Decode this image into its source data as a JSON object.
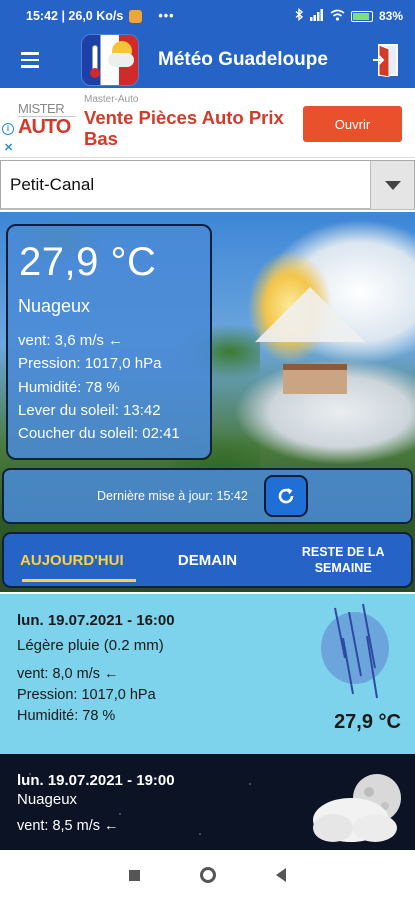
{
  "status_bar": {
    "time_speed": "15:42 | 26,0 Ko/s",
    "dots": "•••",
    "battery": "83"
  },
  "header": {
    "title": "Météo Guadeloupe"
  },
  "ad": {
    "logo_line1": "MISTER",
    "logo_line2": "AUTO",
    "brand": "Master-Auto",
    "headline": "Vente Pièces Auto Prix Bas",
    "button": "Ouvrir"
  },
  "location": {
    "selected": "Petit-Canal"
  },
  "current": {
    "temperature": "27,9 °C",
    "condition": "Nuageux",
    "wind": "vent: 3,6 m/s ←",
    "pressure": "Pression: 1017,0 hPa",
    "humidity": "Humidité: 78 %",
    "sunrise": "Lever du soleil: 13:42",
    "sunset": "Coucher du soleil: 02:41"
  },
  "update": {
    "text": "Dernière mise à jour: 15:42"
  },
  "tabs": [
    {
      "label": "AUJOURD'HUI"
    },
    {
      "label": "DEMAIN"
    },
    {
      "label": "RESTE DE LA SEMAINE"
    }
  ],
  "forecast": [
    {
      "date": "lun. 19.07.2021 - 16:00",
      "condition": "Légère pluie (0.2 mm)",
      "wind": "vent: 8,0 m/s ←",
      "pressure": "Pression: 1017,0 hPa",
      "humidity": "Humidité: 78 %",
      "temperature": "27,9 °C",
      "icon": "rain-icon"
    },
    {
      "date": "lun. 19.07.2021 - 19:00",
      "condition": "Nuageux",
      "wind": "vent: 8,5 m/s ←",
      "icon": "cloud-moon-icon"
    }
  ],
  "colors": {
    "primary": "#2563c7",
    "accent_tab": "#ffd23b",
    "ad_red": "#d23b2a",
    "forecast_day_bg": "#7dd3ec",
    "forecast_night_bg": "#0b1324"
  }
}
